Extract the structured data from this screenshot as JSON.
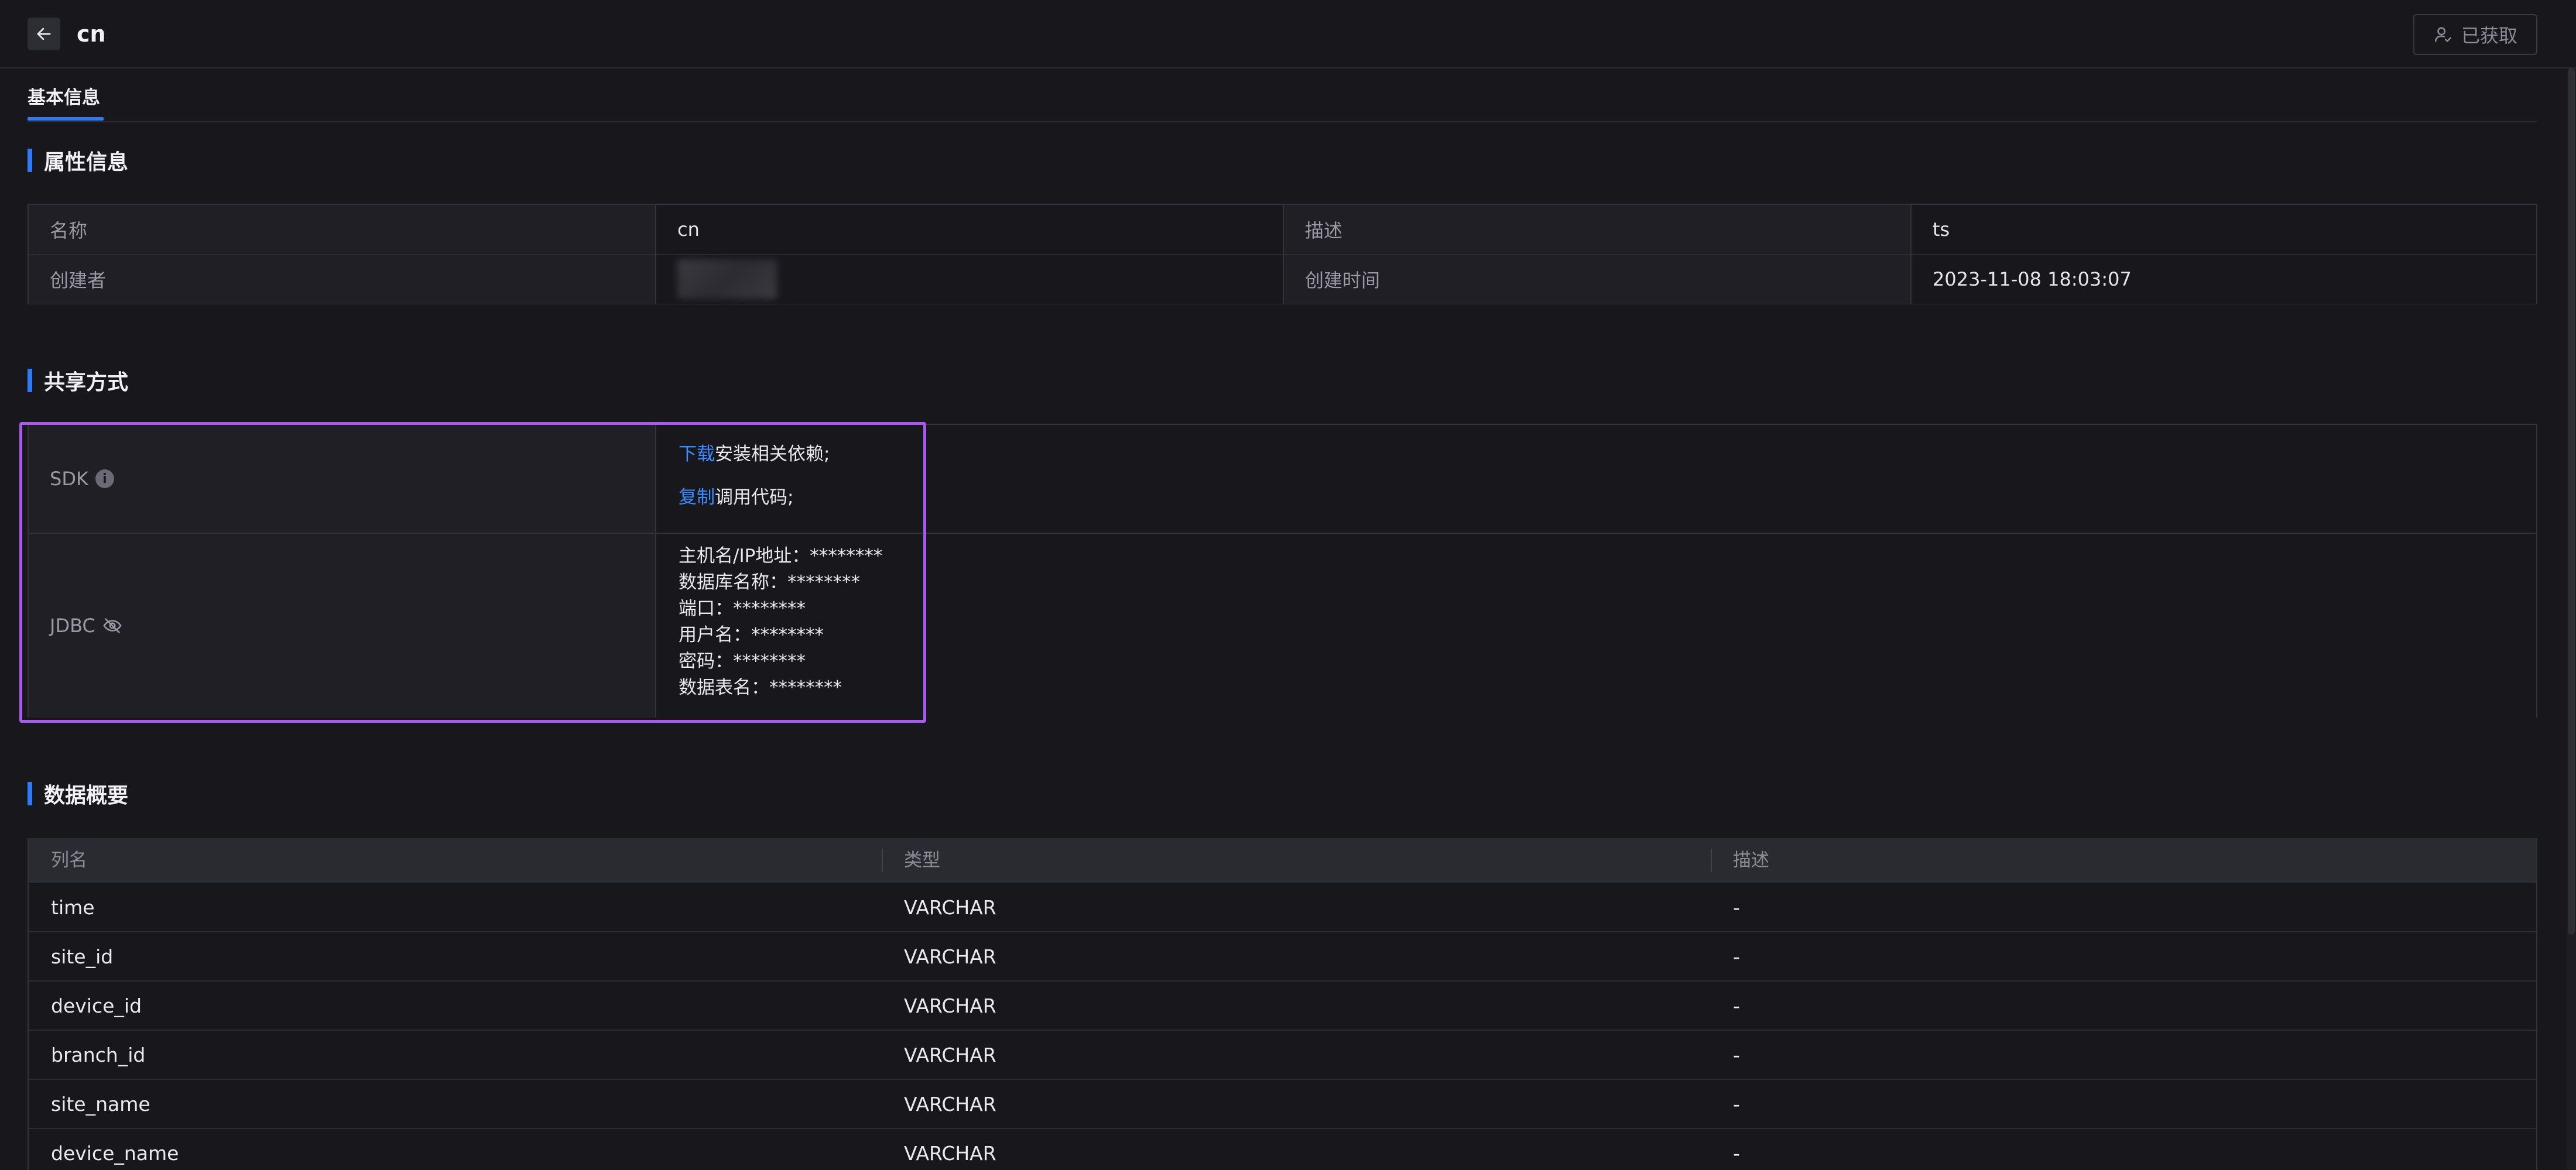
{
  "header": {
    "title": "cn",
    "acquired_label": "已获取"
  },
  "tabs": [
    {
      "label": "基本信息",
      "active": true
    }
  ],
  "attributes": {
    "section_title": "属性信息",
    "rows": [
      {
        "label1": "名称",
        "value1": "cn",
        "label2": "描述",
        "value2": "ts"
      },
      {
        "label1": "创建者",
        "value1": "",
        "label2": "创建时间",
        "value2": "2023-11-08 18:03:07"
      }
    ]
  },
  "share": {
    "section_title": "共享方式",
    "sdk": {
      "label": "SDK",
      "line1_link": "下载",
      "line1_text": "安装相关依赖;",
      "line2_link": "复制",
      "line2_text": "调用代码;"
    },
    "jdbc": {
      "label": "JDBC",
      "lines": [
        "主机名/IP地址：********",
        "数据库名称：********",
        "端口：********",
        "用户名：********",
        "密码：********",
        "数据表名：********"
      ]
    }
  },
  "overview": {
    "section_title": "数据概要",
    "columns": [
      "列名",
      "类型",
      "描述"
    ],
    "rows": [
      [
        "time",
        "VARCHAR",
        "-"
      ],
      [
        "site_id",
        "VARCHAR",
        "-"
      ],
      [
        "device_id",
        "VARCHAR",
        "-"
      ],
      [
        "branch_id",
        "VARCHAR",
        "-"
      ],
      [
        "site_name",
        "VARCHAR",
        "-"
      ],
      [
        "device_name",
        "VARCHAR",
        "-"
      ]
    ]
  },
  "colors": {
    "accent": "#2f7bf5",
    "link": "#3d8cff",
    "highlight": "#a958f0",
    "background": "#17171c"
  }
}
